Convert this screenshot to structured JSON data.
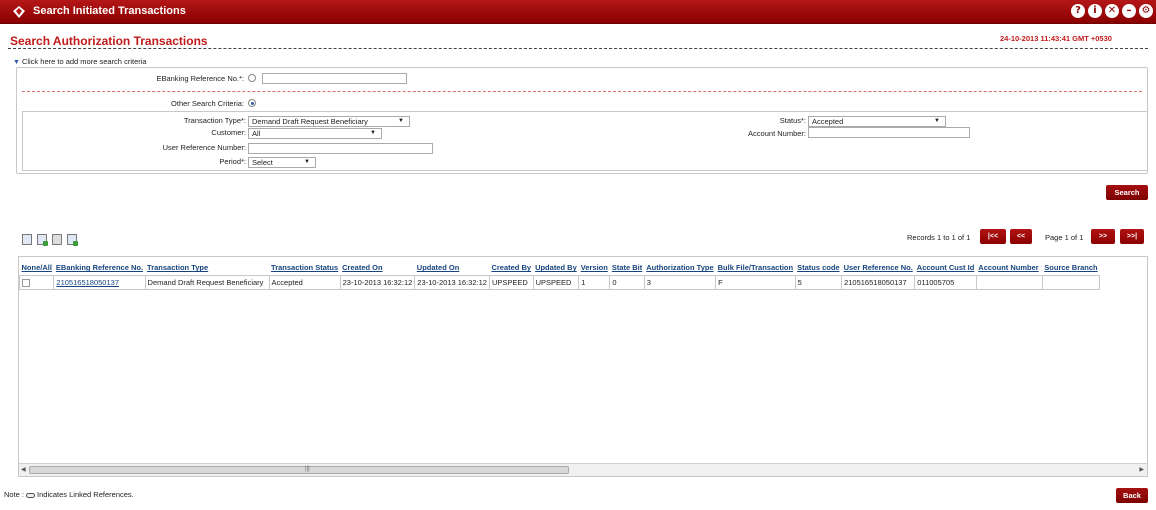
{
  "window": {
    "title": "Search Initiated Transactions",
    "icons": [
      "help-icon",
      "info-icon",
      "close-icon",
      "minimize-icon",
      "settings-icon"
    ],
    "icon_glyphs": [
      "?",
      "i",
      "✕",
      "–",
      "⚙"
    ]
  },
  "page": {
    "heading": "Search Authorization Transactions",
    "timestamp": "24-10-2013 11:43:41 GMT +0530",
    "add_criteria": "Click here to add more search criteria"
  },
  "criteria": {
    "ebanking_ref_label": "EBanking Reference No.*:",
    "ebanking_ref_value": "",
    "other_label": "Other Search Criteria:",
    "txn_type_label": "Transaction Type*:",
    "txn_type_value": "Demand Draft Request Beneficiary",
    "customer_label": "Customer:",
    "customer_value": "All",
    "user_ref_label": "User Reference Number:",
    "user_ref_value": "",
    "period_label": "Period*:",
    "period_value": "Select",
    "status_label": "Status*:",
    "status_value": "Accepted",
    "account_label": "Account Number:",
    "account_value": ""
  },
  "buttons": {
    "search": "Search",
    "back": "Back"
  },
  "pager": {
    "records": "Records 1 to 1 of 1",
    "first": "|<<",
    "prev": "<<",
    "page": "Page 1 of 1",
    "next": ">>",
    "last": ">>|"
  },
  "grid": {
    "headers": [
      "None/All",
      "EBanking Reference No.",
      "Transaction Type",
      "Transaction Status",
      "Created On",
      "Updated On",
      "Created By",
      "Updated By",
      "Version",
      "State Bit",
      "Authorization Type",
      "Bulk File/Transaction",
      "Status code",
      "User Reference No.",
      "Account Cust Id",
      "Account Number",
      "Source Branch"
    ],
    "rows": [
      [
        "",
        "210516518050137",
        "Demand Draft Request Beneficiary",
        "Accepted",
        "23-10-2013 16:32:12",
        "23-10-2013 16:32:12",
        "UPSPEED",
        "UPSPEED",
        "1",
        "0",
        "3",
        "F",
        "5",
        "210516518050137",
        "011005705",
        "",
        ""
      ]
    ]
  },
  "note": {
    "prefix": "Note :",
    "suffix": "Indicates Linked References."
  },
  "colors": {
    "brand": "#8a0000",
    "heading": "#c01a1a",
    "link": "#16447f"
  }
}
